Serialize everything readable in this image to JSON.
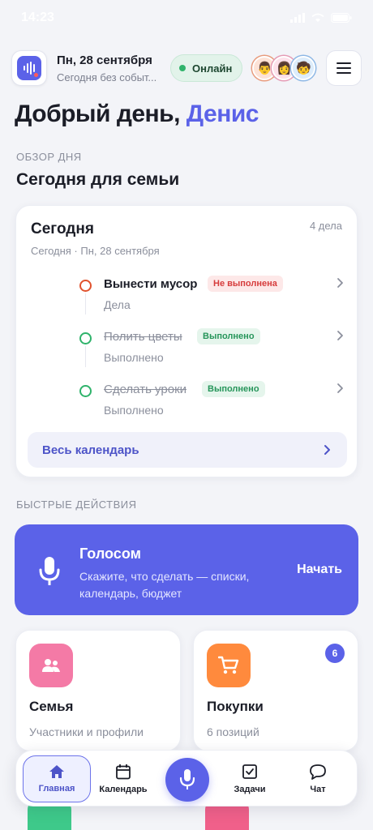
{
  "status_bar": {
    "time": "14:23"
  },
  "header": {
    "date": "Пн, 28 сентября",
    "subtitle": "Сегодня без событ...",
    "online_label": "Онлайн",
    "avatars": [
      "👨",
      "👩",
      "🧒"
    ]
  },
  "greeting": {
    "prefix": "Добрый день, ",
    "name": "Денис"
  },
  "overview": {
    "section_label": "ОБЗОР ДНЯ",
    "section_title": "Сегодня для семьи"
  },
  "today_card": {
    "title": "Сегодня",
    "count": "4 дела",
    "subtitle": "Сегодня · Пн, 28 сентября",
    "tasks": [
      {
        "title": "Вынести мусор",
        "badge": "Не выполнена",
        "sub": "Дела",
        "status": "pending"
      },
      {
        "title": "Полить цветы",
        "badge": "Выполнено",
        "sub": "Выполнено",
        "status": "done"
      },
      {
        "title": "Сделать уроки",
        "badge": "Выполнено",
        "sub": "Выполнено",
        "status": "done"
      }
    ],
    "calendar_button": "Весь календарь"
  },
  "quick_actions": {
    "section_label": "БЫСТРЫЕ ДЕЙСТВИЯ",
    "voice": {
      "title": "Голосом",
      "description": "Скажите, что сделать — списки, календарь, бюджет",
      "action": "Начать"
    },
    "tiles": [
      {
        "title": "Семья",
        "sub": "Участники и профили",
        "icon": "people-icon",
        "color": "#f47aa6"
      },
      {
        "title": "Покупки",
        "sub": "6 позиций",
        "icon": "cart-icon",
        "color": "#ff8a3d",
        "badge": "6"
      }
    ]
  },
  "bottom_nav": {
    "items": [
      {
        "label": "Главная",
        "icon": "home-icon"
      },
      {
        "label": "Календарь",
        "icon": "calendar-icon"
      },
      {
        "label": "Задачи",
        "icon": "checkbox-icon"
      },
      {
        "label": "Чат",
        "icon": "chat-icon"
      }
    ],
    "active": "Главная"
  },
  "colors": {
    "accent": "#5b62e8",
    "success": "#2fb36b",
    "danger": "#e0522d",
    "background": "#f3f4f8"
  }
}
